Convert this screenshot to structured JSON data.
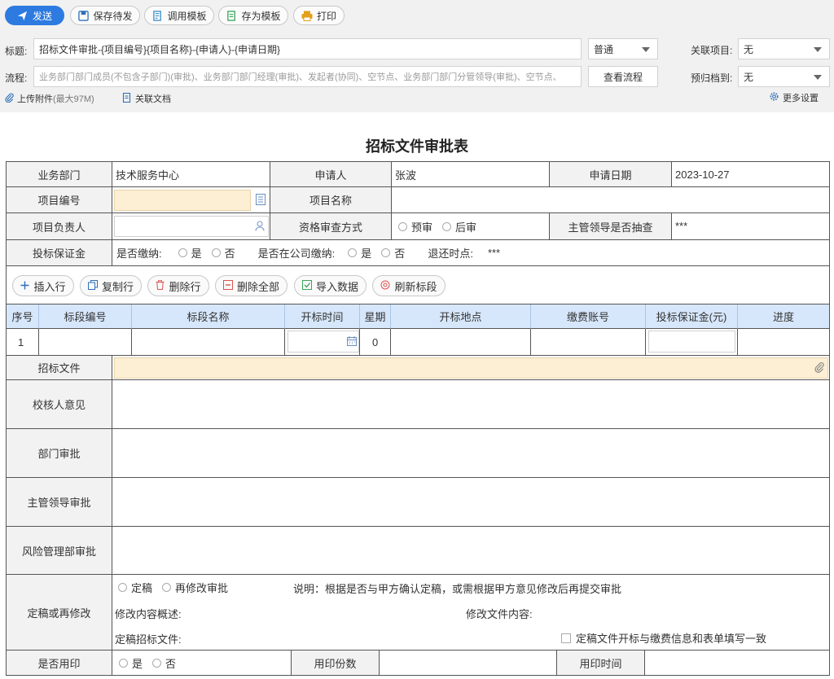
{
  "toolbar": {
    "send": "发送",
    "save_draft": "保存待发",
    "apply_template": "调用模板",
    "save_template": "存为模板",
    "print": "打印"
  },
  "header": {
    "title_label": "标题:",
    "title_value": "招标文件审批-{项目编号}{项目名称}-{申请人}-{申请日期}",
    "priority": "普通",
    "related_project_label": "关联项目:",
    "related_project_value": "无",
    "flow_label": "流程:",
    "flow_value": "业务部门部门成员(不包含子部门)(审批)、业务部门部门经理(审批)、发起者(协同)、空节点、业务部门部门分管领导(审批)、空节点、",
    "view_flow": "查看流程",
    "archive_label": "预归档到:",
    "archive_value": "无",
    "upload": "上传附件",
    "upload_limit": "(最大97M)",
    "related_doc": "关联文档",
    "more_settings": "更多设置"
  },
  "form": {
    "title": "招标文件审批表",
    "dept_label": "业务部门",
    "dept_value": "技术服务中心",
    "applicant_label": "申请人",
    "applicant_value": "张波",
    "date_label": "申请日期",
    "date_value": "2023-10-27",
    "project_no_label": "项目编号",
    "project_name_label": "项目名称",
    "project_lead_label": "项目负责人",
    "qual_review_label": "资格审查方式",
    "pre_review": "预审",
    "post_review": "后审",
    "spot_check_label": "主管领导是否抽查",
    "spot_check_value": "***",
    "deposit_label": "投标保证金",
    "paid_q": "是否缴纳:",
    "yes": "是",
    "no": "否",
    "paid_company_q": "是否在公司缴纳:",
    "refund_label": "退还时点:",
    "refund_value": "***",
    "tender_file_label": "招标文件",
    "reviewer_label": "校核人意见",
    "dept_approval_label": "部门审批",
    "leader_approval_label": "主管领导审批",
    "risk_label": "风险管理部审批",
    "finalize_label": "定稿或再修改",
    "finalize": "定稿",
    "re_review": "再修改审批",
    "note": "说明：根据是否与甲方确认定稿，或需根据甲方意见修改后再提交审批",
    "change_summary": "修改内容概述:",
    "change_file": "修改文件内容:",
    "final_file": "定稿招标文件:",
    "consistent": "定稿文件开标与缴费信息和表单填写一致",
    "seal_label": "是否用印",
    "seal_copies": "用印份数",
    "seal_time": "用印时间"
  },
  "table_actions": {
    "insert_row": "插入行",
    "copy_row": "复制行",
    "delete_row": "删除行",
    "delete_all": "删除全部",
    "import_data": "导入数据",
    "refresh": "刷新标段"
  },
  "table": {
    "headers": [
      "序号",
      "标段编号",
      "标段名称",
      "开标时间",
      "星期",
      "开标地点",
      "缴费账号",
      "投标保证金(元)",
      "进度"
    ],
    "row": {
      "no": "1",
      "weekday": "0"
    }
  },
  "colors": {
    "primary": "#2d7be0",
    "header_bg": "#d7e7fb",
    "highlight": "#fdefd4"
  }
}
